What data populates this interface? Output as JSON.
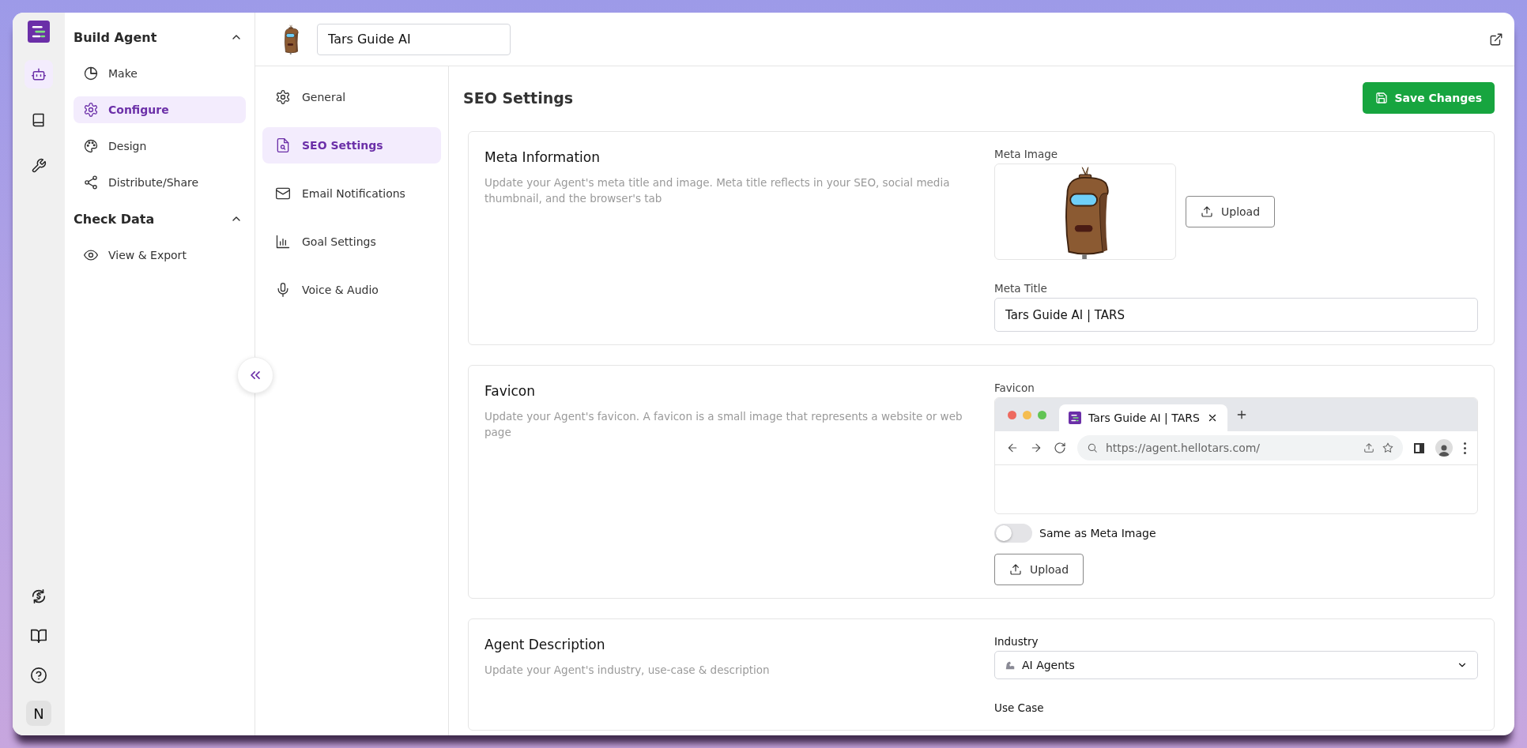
{
  "rail": {
    "items": [
      {
        "kind": "robot",
        "selected": true
      },
      {
        "kind": "book",
        "selected": false
      },
      {
        "kind": "wrench",
        "selected": false
      }
    ],
    "bottom_items": [
      {
        "kind": "billing"
      },
      {
        "kind": "docs"
      },
      {
        "kind": "help"
      }
    ],
    "avatar": "N"
  },
  "sidebar": {
    "sections": [
      {
        "title": "Build Agent",
        "expanded": true,
        "items": [
          {
            "label": "Make",
            "kind": "pie",
            "selected": false
          },
          {
            "label": "Configure",
            "kind": "gear",
            "selected": true
          },
          {
            "label": "Design",
            "kind": "palette",
            "selected": false
          },
          {
            "label": "Distribute/Share",
            "kind": "share",
            "selected": false
          }
        ]
      },
      {
        "title": "Check Data",
        "expanded": true,
        "items": [
          {
            "label": "View & Export",
            "kind": "eye",
            "selected": false
          }
        ]
      }
    ]
  },
  "header": {
    "agent_name": "Tars Guide AI"
  },
  "settings_nav": {
    "items": [
      {
        "label": "General",
        "kind": "gear",
        "selected": false
      },
      {
        "label": "SEO Settings",
        "kind": "file-search",
        "selected": true
      },
      {
        "label": "Email Notifications",
        "kind": "mail",
        "selected": false
      },
      {
        "label": "Goal Settings",
        "kind": "chart",
        "selected": false
      },
      {
        "label": "Voice & Audio",
        "kind": "mic",
        "selected": false
      }
    ]
  },
  "page": {
    "title": "SEO Settings",
    "save_button": "Save Changes"
  },
  "meta_information": {
    "title": "Meta Information",
    "description": "Update your Agent's meta title and image. Meta title reflects in your SEO, social media thumbnail, and the browser's tab",
    "image_label": "Meta Image",
    "upload_button": "Upload",
    "title_label": "Meta Title",
    "title_value": "Tars Guide AI | TARS"
  },
  "favicon": {
    "title": "Favicon",
    "description": "Update your Agent's favicon. A favicon is a small image that represents a website or web page",
    "label": "Favicon",
    "browser": {
      "tab_title": "Tars Guide AI | TARS",
      "url": "https://agent.hellotars.com/"
    },
    "toggle": {
      "label": "Same as Meta Image",
      "on": false
    },
    "upload_button": "Upload"
  },
  "agent_description": {
    "title": "Agent Description",
    "description": "Update your Agent's industry, use-case & description",
    "industry_label": "Industry",
    "industry_value": "AI Agents",
    "use_case_label": "Use Case"
  }
}
